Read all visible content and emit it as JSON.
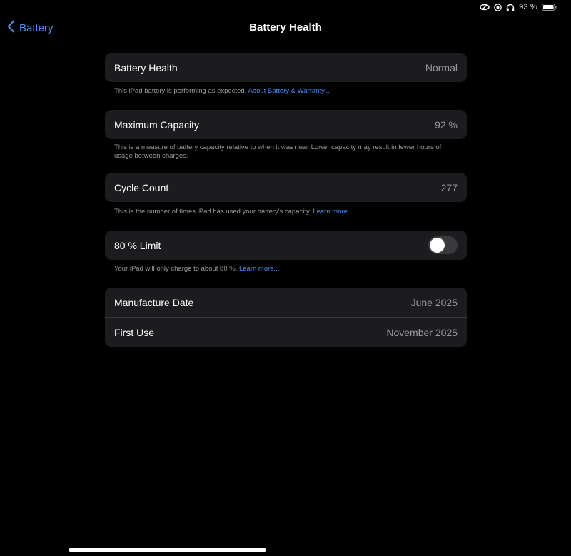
{
  "status_bar": {
    "icons": [
      "link-icon",
      "location-icon",
      "headphones-icon",
      "battery-icon"
    ],
    "battery_text": "93 %"
  },
  "nav": {
    "back_label": "Battery",
    "title": "Battery Health"
  },
  "battery_health": {
    "label": "Battery Health",
    "value": "Normal",
    "footnote": "This iPad battery is performing as expected.",
    "footnote_link": "About Battery & Warranty..."
  },
  "max_capacity": {
    "label": "Maximum Capacity",
    "value": "92 %",
    "footnote": "This is a measure of battery capacity relative to when it was new. Lower capacity may result in fewer hours of usage between charges."
  },
  "cycle_count": {
    "label": "Cycle Count",
    "value": "277",
    "footnote": "This is the number of times iPad has used your battery's capacity.",
    "footnote_link": "Learn more..."
  },
  "limit": {
    "label": "80 % Limit",
    "enabled": false,
    "footnote": "Your iPad will only charge to about 80 %.",
    "footnote_link": "Learn more..."
  },
  "dates": {
    "manufacture_label": "Manufacture Date",
    "manufacture_value": "June 2025",
    "first_use_label": "First Use",
    "first_use_value": "November 2025"
  },
  "colors": {
    "accent": "#4e8ef7",
    "background": "#000000",
    "cell": "#1c1c1e"
  }
}
